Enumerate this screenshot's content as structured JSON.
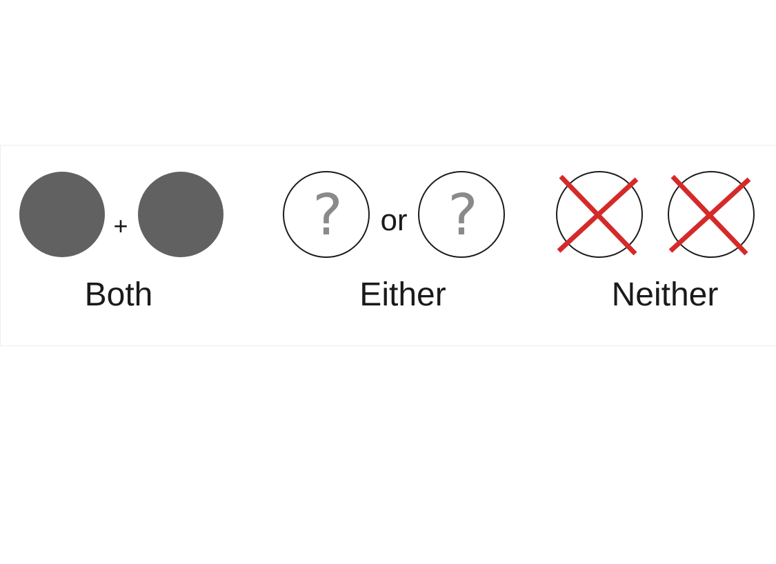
{
  "groups": [
    {
      "id": "both",
      "label": "Both",
      "connector": "+",
      "circle_style": "filled"
    },
    {
      "id": "either",
      "label": "Either",
      "connector": "or",
      "circle_style": "question"
    },
    {
      "id": "neither",
      "label": "Neither",
      "connector": "",
      "circle_style": "crossed"
    }
  ],
  "symbols": {
    "question_mark": "?"
  },
  "colors": {
    "filled_circle": "#616161",
    "outline": "#1a1a1a",
    "question_mark": "#8a8a8a",
    "cross": "#d42a2a",
    "text": "#1a1a1a"
  }
}
